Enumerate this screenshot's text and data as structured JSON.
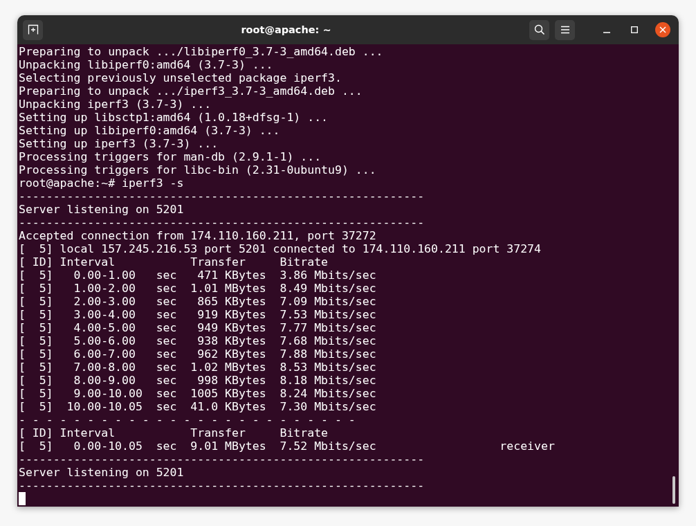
{
  "window": {
    "title": "root@apache: ~"
  },
  "terminal": {
    "lines": [
      "Preparing to unpack .../libiperf0_3.7-3_amd64.deb ...",
      "Unpacking libiperf0:amd64 (3.7-3) ...",
      "Selecting previously unselected package iperf3.",
      "Preparing to unpack .../iperf3_3.7-3_amd64.deb ...",
      "Unpacking iperf3 (3.7-3) ...",
      "Setting up libsctp1:amd64 (1.0.18+dfsg-1) ...",
      "Setting up libiperf0:amd64 (3.7-3) ...",
      "Setting up iperf3 (3.7-3) ...",
      "Processing triggers for man-db (2.9.1-1) ...",
      "Processing triggers for libc-bin (2.31-0ubuntu9) ...",
      "root@apache:~# iperf3 -s",
      "-----------------------------------------------------------",
      "Server listening on 5201",
      "-----------------------------------------------------------",
      "Accepted connection from 174.110.160.211, port 37272",
      "[  5] local 157.245.216.53 port 5201 connected to 174.110.160.211 port 37274",
      "[ ID] Interval           Transfer     Bitrate",
      "[  5]   0.00-1.00   sec   471 KBytes  3.86 Mbits/sec",
      "[  5]   1.00-2.00   sec  1.01 MBytes  8.49 Mbits/sec",
      "[  5]   2.00-3.00   sec   865 KBytes  7.09 Mbits/sec",
      "[  5]   3.00-4.00   sec   919 KBytes  7.53 Mbits/sec",
      "[  5]   4.00-5.00   sec   949 KBytes  7.77 Mbits/sec",
      "[  5]   5.00-6.00   sec   938 KBytes  7.68 Mbits/sec",
      "[  5]   6.00-7.00   sec   962 KBytes  7.88 Mbits/sec",
      "[  5]   7.00-8.00   sec  1.02 MBytes  8.53 Mbits/sec",
      "[  5]   8.00-9.00   sec   998 KBytes  8.18 Mbits/sec",
      "[  5]   9.00-10.00  sec  1005 KBytes  8.24 Mbits/sec",
      "[  5]  10.00-10.05  sec  41.0 KBytes  7.30 Mbits/sec",
      "- - - - - - - - - - - - - - - - - - - - - - - - -",
      "[ ID] Interval           Transfer     Bitrate",
      "[  5]   0.00-10.05  sec  9.01 MBytes  7.52 Mbits/sec                  receiver",
      "-----------------------------------------------------------",
      "Server listening on 5201",
      "-----------------------------------------------------------"
    ]
  }
}
